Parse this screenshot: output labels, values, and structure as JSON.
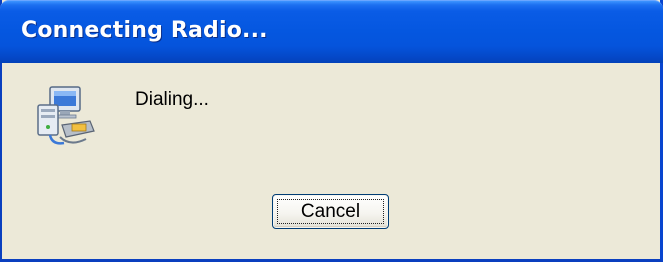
{
  "window": {
    "title": "Connecting Radio..."
  },
  "status": {
    "message": "Dialing...",
    "icon": "network-connection-icon"
  },
  "buttons": {
    "cancel_label": "Cancel"
  },
  "colors": {
    "titlebar": "#0557e0",
    "dialog_bg": "#ece9d8",
    "window_border": "#0a3fbf",
    "button_border": "#003c74"
  }
}
